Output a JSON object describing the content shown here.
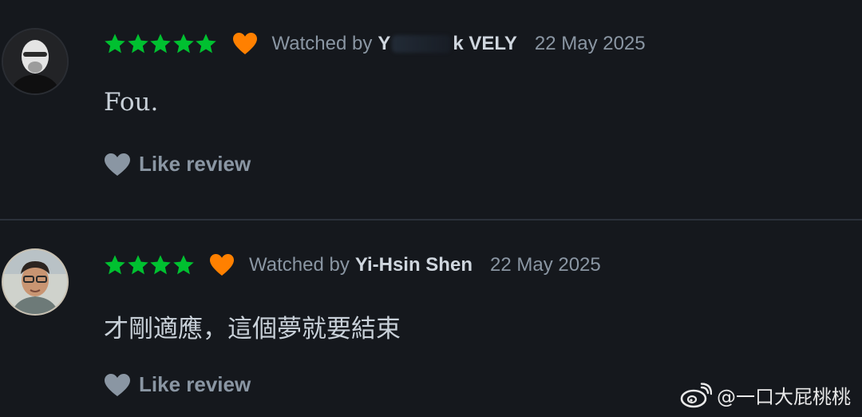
{
  "reviews": [
    {
      "rating_stars": 5,
      "liked": true,
      "watched_prefix": "Watched by",
      "user_name_start": "Y",
      "user_name_end": "k VELY",
      "date": "22 May 2025",
      "text": "Fou.",
      "like_label": "Like review"
    },
    {
      "rating_stars": 4,
      "liked": true,
      "watched_prefix": "Watched by",
      "user_name": "Yi-Hsin Shen",
      "date": "22 May 2025",
      "text": "才剛適應，這個夢就要結束",
      "like_label": "Like review"
    }
  ],
  "watermark": {
    "icon": "weibo-icon",
    "text": "@一口大屁桃桃"
  },
  "colors": {
    "background": "#15181d",
    "star": "#00c030",
    "heart": "#ff8000",
    "muted_text": "#8a96a3",
    "user_text": "#cfd6de"
  }
}
